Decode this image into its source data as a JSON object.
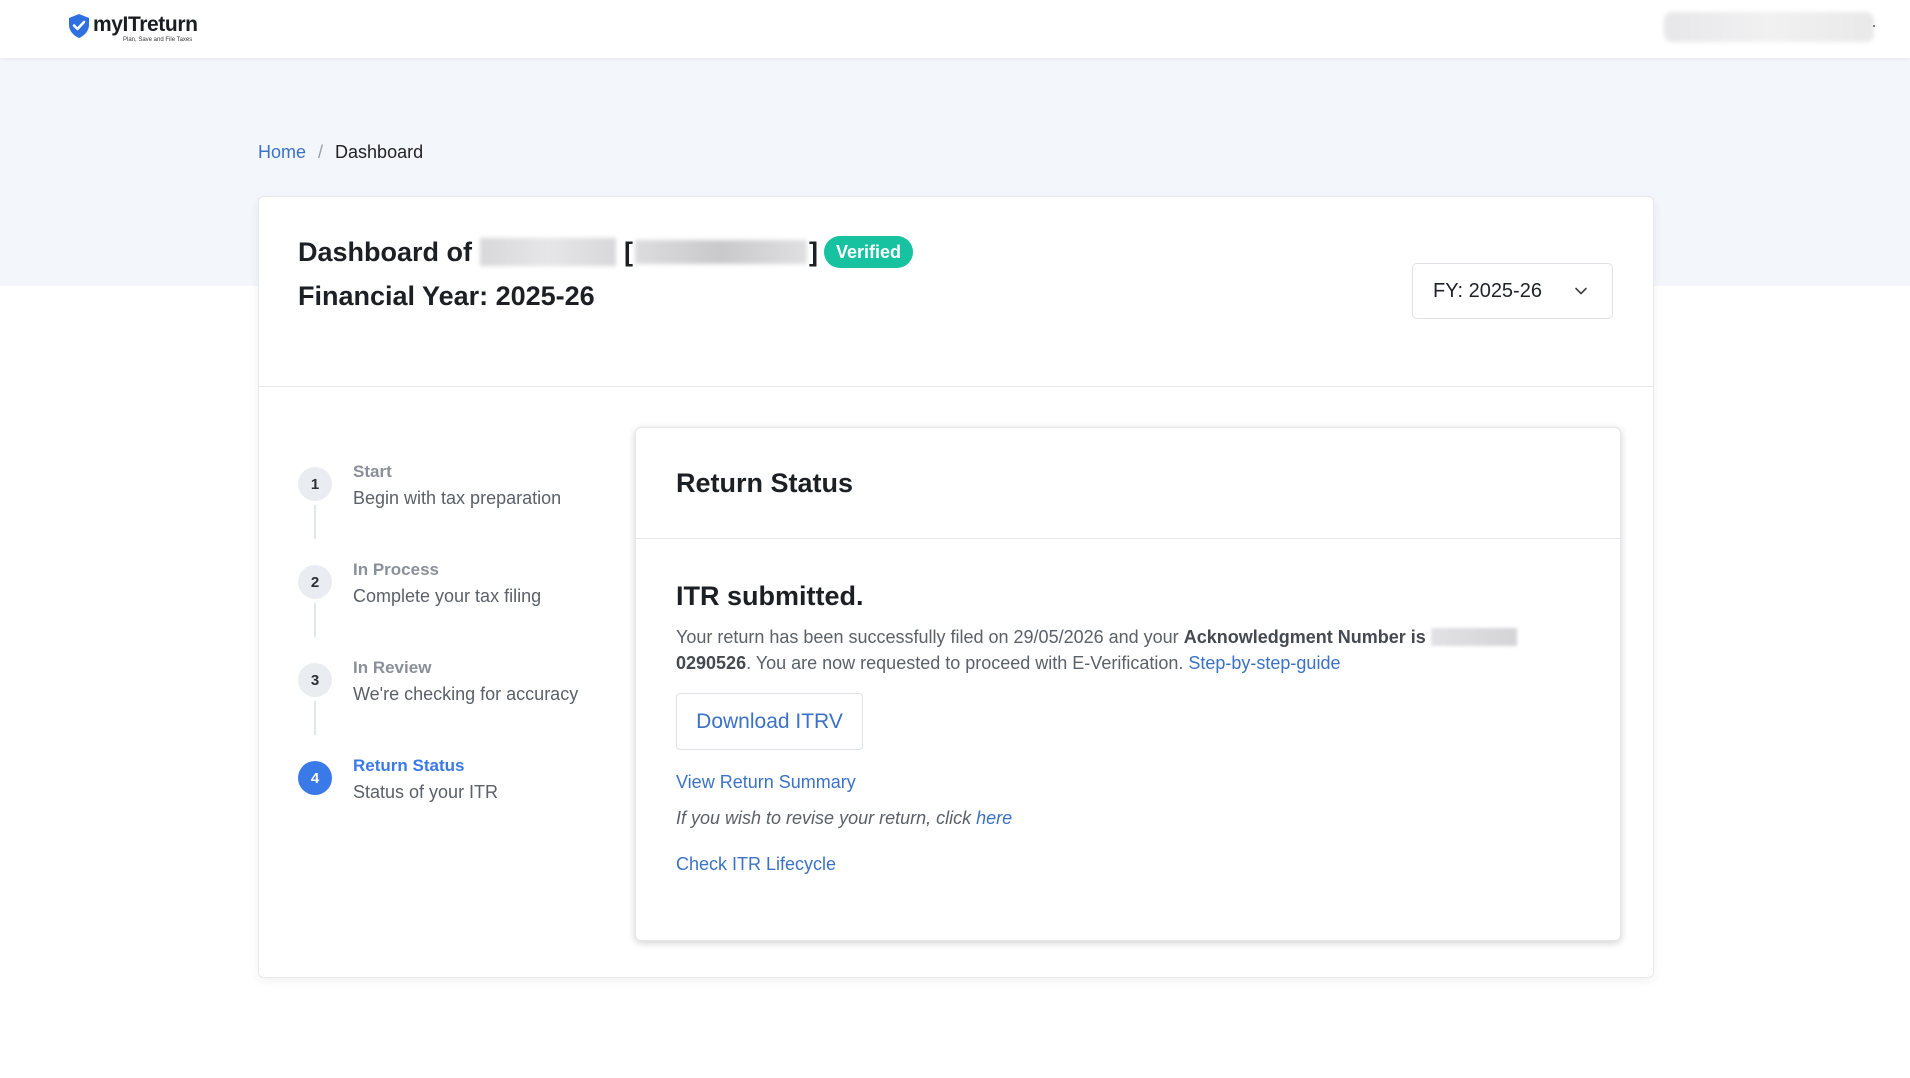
{
  "brand": {
    "name": "myITreturn",
    "tagline": "Plan, Save and File Taxes",
    "accent": "#3a7ae8",
    "success": "#16c2a0"
  },
  "breadcrumb": {
    "home": "Home",
    "separator": "/",
    "current": "Dashboard"
  },
  "dashboard": {
    "title_prefix": "Dashboard of",
    "bracket_open": "[",
    "bracket_close": "]",
    "verified_badge": "Verified",
    "financial_year": "Financial Year: 2025-26",
    "fy_select": "FY: 2025-26"
  },
  "steps": [
    {
      "number": "1",
      "title": "Start",
      "subtitle": "Begin with tax preparation",
      "active": false
    },
    {
      "number": "2",
      "title": "In Process",
      "subtitle": "Complete your tax filing",
      "active": false
    },
    {
      "number": "3",
      "title": "In Review",
      "subtitle": "We're checking for accuracy",
      "active": false
    },
    {
      "number": "4",
      "title": "Return Status",
      "subtitle": "Status of your ITR",
      "active": true
    }
  ],
  "return_status": {
    "heading": "Return Status",
    "itr_title": "ITR submitted.",
    "msg_part1": "Your return has been successfully filed on 29/05/2026 and your",
    "msg_bold1": "Acknowledgment Number is",
    "msg_bold2": "0290526",
    "msg_part2": ". You are now requested to proceed with E-Verification.",
    "guide_link": "Step-by-step-guide",
    "download_button": "Download ITRV",
    "view_summary_link": "View Return Summary",
    "revise_text": "If you wish to revise your return, click",
    "revise_link": "here",
    "lifecycle_link": "Check ITR Lifecycle"
  }
}
